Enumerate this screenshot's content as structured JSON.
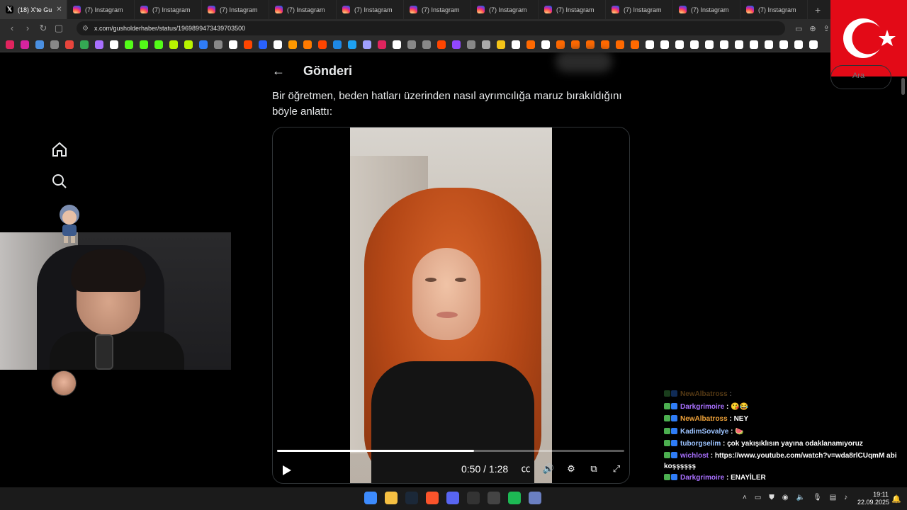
{
  "browser": {
    "tabs": [
      {
        "title": "(18) X'te Gu",
        "favicon": "x",
        "active": true
      },
      {
        "title": "(7) Instagram",
        "favicon": "instagram"
      },
      {
        "title": "(7) Instagram",
        "favicon": "instagram"
      },
      {
        "title": "(7) Instagram",
        "favicon": "instagram"
      },
      {
        "title": "(7) Instagram",
        "favicon": "instagram"
      },
      {
        "title": "(7) Instagram",
        "favicon": "instagram"
      },
      {
        "title": "(7) Instagram",
        "favicon": "instagram"
      },
      {
        "title": "(7) Instagram",
        "favicon": "instagram"
      },
      {
        "title": "(7) Instagram",
        "favicon": "instagram"
      },
      {
        "title": "(7) Instagram",
        "favicon": "instagram"
      },
      {
        "title": "(7) Instagram",
        "favicon": "instagram"
      },
      {
        "title": "(7) Instagram",
        "favicon": "instagram"
      }
    ],
    "new_tab_label": "+",
    "url": "x.com/gusholderhaber/status/1969899473439703500",
    "bookmark_colors": [
      "#e0245e",
      "#d6249f",
      "#4a90e2",
      "#888",
      "#e8453c",
      "#34a853",
      "#a970ff",
      "#fff",
      "#53fc18",
      "#53fc18",
      "#53fc18",
      "#b8f400",
      "#b8f400",
      "#2f7cf6",
      "#888",
      "#fff",
      "#ff4500",
      "#2962ff",
      "#fff",
      "#ff9900",
      "#ff7a00",
      "#ff4500",
      "#1e88e5",
      "#1da1f2",
      "#a0a0ff",
      "#e0245e",
      "#fff",
      "#888",
      "#888",
      "#ff4500",
      "#9147ff",
      "#888",
      "#aaa",
      "#f5c518",
      "#fff",
      "#ff6900",
      "#fff",
      "#ff6900",
      "#ff6900",
      "#ff6900",
      "#ff6900",
      "#ff6900",
      "#ff6900",
      "#fff",
      "#fff",
      "#fff",
      "#fff",
      "#fff",
      "#fff",
      "#fff",
      "#fff",
      "#fff",
      "#fff",
      "#fff",
      "#fff",
      "#fff"
    ]
  },
  "post": {
    "title": "Gönderi",
    "text": "Bir öğretmen, beden hatları üzerinden nasıl ayrımcılığa maruz bırakıldığını böyle anlattı:",
    "search_placeholder": "Ara"
  },
  "video": {
    "time_current": "0:50",
    "time_separator": "/",
    "time_total": "1:28",
    "progress": 0.568,
    "controls": [
      "captions-icon",
      "volume-icon",
      "settings-icon",
      "picture-in-picture-icon",
      "fullscreen-icon"
    ]
  },
  "chat": [
    {
      "user": "NewAlbatross",
      "message": ":",
      "color": "#f0a33a",
      "faded": true
    },
    {
      "user": "Darkgrimoire",
      "message": ": 😘😂",
      "color": "#a970ff"
    },
    {
      "user": "NewAlbatross",
      "message": ": NEY",
      "color": "#f0a33a"
    },
    {
      "user": "KadimSovalye",
      "message": ": 🍉",
      "color": "#9cc3ff"
    },
    {
      "user": "tuborgselim",
      "message": ": çok yakışıklısın yayına odaklanamıyoruz",
      "color": "#9cc3ff"
    },
    {
      "user": "wichlost",
      "message": ": https://www.youtube.com/watch?v=wda8rlCUqmM abi koşşşşşş",
      "color": "#a970ff",
      "wrap": true
    },
    {
      "user": "Darkgrimoire",
      "message": ": ENAYİLER",
      "color": "#a970ff"
    }
  ],
  "taskbar": {
    "time": "19:11",
    "date": "22.09.2025",
    "icon_colors": [
      "#3d8bfd",
      "#f6c042",
      "#1b2838",
      "#fb542b",
      "#5865f2",
      "#333",
      "#444",
      "#1db954",
      "#6a7fc1"
    ]
  }
}
